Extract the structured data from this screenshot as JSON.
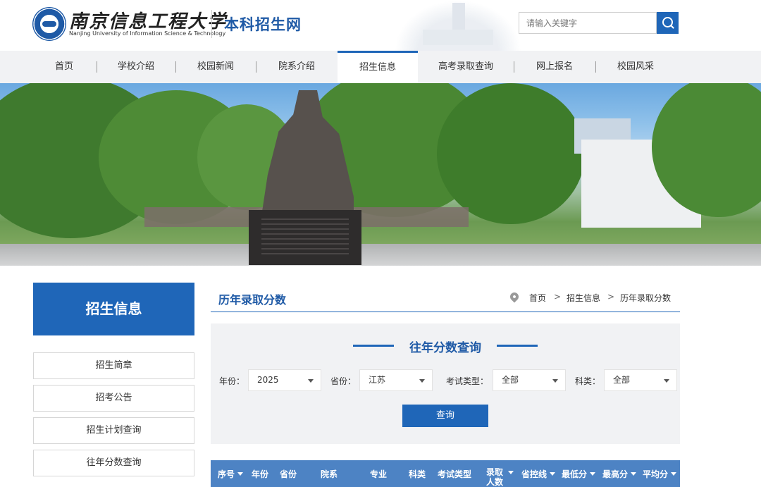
{
  "header": {
    "logo_cn": "南京信息工程大学",
    "logo_en": "Nanjing University of Information Science & Technology",
    "site_title": "本科招生网",
    "search_placeholder": "请输入关键字"
  },
  "nav": {
    "items": [
      {
        "label": "首页",
        "active": false
      },
      {
        "label": "学校介绍",
        "active": false
      },
      {
        "label": "校园新闻",
        "active": false
      },
      {
        "label": "院系介绍",
        "active": false
      },
      {
        "label": "招生信息",
        "active": true
      },
      {
        "label": "高考录取查询",
        "active": false
      },
      {
        "label": "网上报名",
        "active": false
      },
      {
        "label": "校园风采",
        "active": false
      }
    ]
  },
  "sidebar": {
    "title": "招生信息",
    "items": [
      {
        "label": "招生简章"
      },
      {
        "label": "招考公告"
      },
      {
        "label": "招生计划查询"
      },
      {
        "label": "往年分数查询"
      }
    ]
  },
  "main": {
    "title": "历年录取分数",
    "breadcrumb": [
      "首页",
      "招生信息",
      "历年录取分数"
    ],
    "breadcrumb_sep": ">",
    "panel_title": "往年分数查询",
    "filters": [
      {
        "label": "年份：",
        "value": "2025"
      },
      {
        "label": "省份：",
        "value": "江苏"
      },
      {
        "label": "考试类型：",
        "value": "全部"
      },
      {
        "label": "科类：",
        "value": "全部"
      }
    ],
    "query_label": "查询",
    "table_headers": [
      {
        "label": "序号",
        "sortable": true
      },
      {
        "label": "年份",
        "sortable": false
      },
      {
        "label": "省份",
        "sortable": false
      },
      {
        "label": "院系",
        "sortable": false
      },
      {
        "label": "专业",
        "sortable": false
      },
      {
        "label": "科类",
        "sortable": false
      },
      {
        "label": "考试类型",
        "sortable": false
      },
      {
        "label": "录取人数",
        "sortable": true
      },
      {
        "label": "省控线",
        "sortable": true
      },
      {
        "label": "最低分",
        "sortable": true
      },
      {
        "label": "最高分",
        "sortable": true
      },
      {
        "label": "平均分",
        "sortable": true
      }
    ]
  },
  "colors": {
    "brand_blue": "#1f66b8",
    "table_header": "#4d83c4",
    "nav_bg": "#f1f2f4"
  }
}
